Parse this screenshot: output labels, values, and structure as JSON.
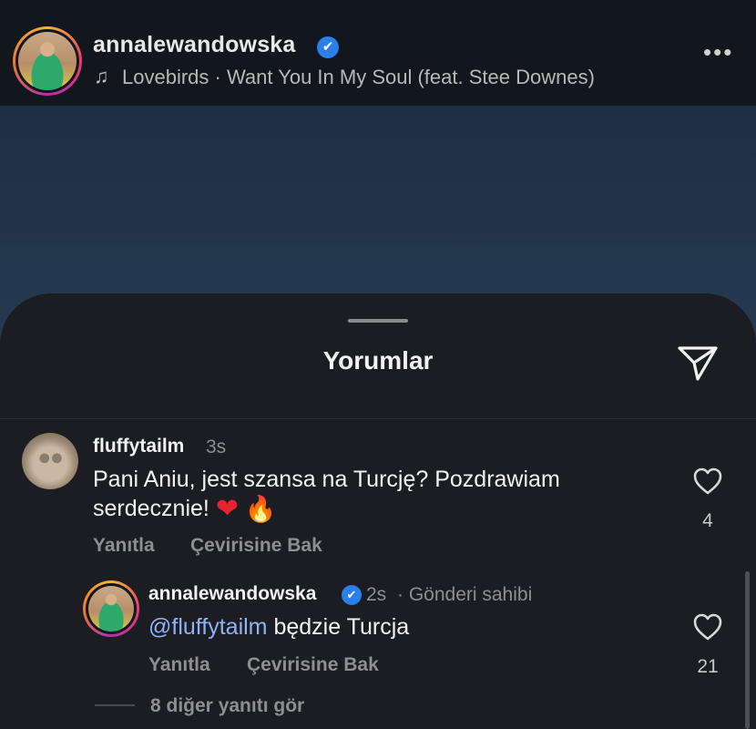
{
  "header": {
    "username": "annalewandowska",
    "verified_mark": "✔",
    "music_icon": "music-note-icon",
    "music": "Lovebirds · Want You In My Soul (feat. Stee Downes)",
    "more_icon": "more-horizontal-icon"
  },
  "sheet": {
    "title": "Yorumlar",
    "send_icon": "send-icon"
  },
  "comments": [
    {
      "username": "fluffytailm",
      "time": "3s",
      "text_line1": "Pani Aniu, jest szansa na Turcję? Pozdrawiam",
      "text_line2": "serdecznie!",
      "emoji_heart": "❤",
      "emoji_fire": "🔥",
      "like_count": "4",
      "reply_label": "Yanıtla",
      "translate_label": "Çevirisine Bak"
    }
  ],
  "reply": {
    "username": "annalewandowska",
    "verified_mark": "✔",
    "time": "2s",
    "owner_label": "· Gönderi sahibi",
    "mention": "@fluffytailm",
    "text": "będzie Turcja",
    "like_count": "21",
    "reply_label": "Yanıtla",
    "translate_label": "Çevirisine Bak"
  },
  "view_more": "8 diğer yanıtı gör",
  "colors": {
    "accent_link": "#8fb3f5",
    "verified": "#2b7fe8",
    "sheet_bg": "#1c1d22"
  }
}
